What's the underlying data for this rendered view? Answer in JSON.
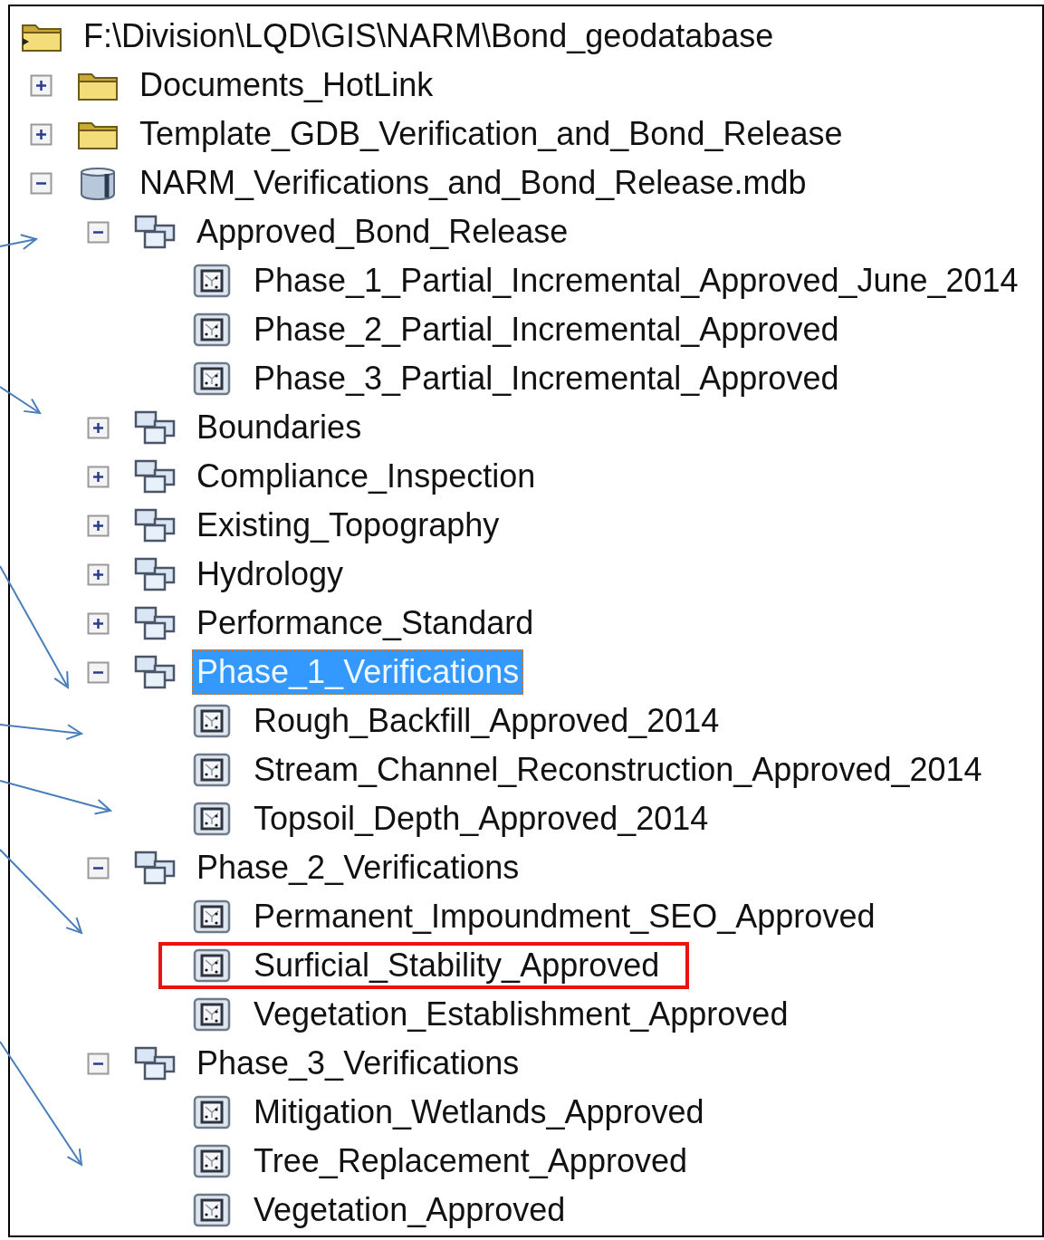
{
  "tree": {
    "label": "F:\\Division\\LQD\\GIS\\NARM\\Bond_geodatabase",
    "kind": "folder_connection",
    "selected": false,
    "boxed": false,
    "children": [
      {
        "label": "Documents_HotLink",
        "kind": "folder",
        "expanded": false,
        "selected": false,
        "boxed": false
      },
      {
        "label": "Template_GDB_Verification_and_Bond_Release",
        "kind": "folder",
        "expanded": false,
        "selected": false,
        "boxed": false
      },
      {
        "label": "NARM_Verifications_and_Bond_Release.mdb",
        "kind": "database",
        "expanded": true,
        "selected": false,
        "boxed": false,
        "children": [
          {
            "label": "Approved_Bond_Release",
            "kind": "dataset",
            "expanded": true,
            "selected": false,
            "boxed": false,
            "children": [
              {
                "label": "Phase_1_Partial_Incremental_Approved_June_2014",
                "kind": "feature_class",
                "selected": false,
                "boxed": false
              },
              {
                "label": "Phase_2_Partial_Incremental_Approved",
                "kind": "feature_class",
                "selected": false,
                "boxed": false
              },
              {
                "label": "Phase_3_Partial_Incremental_Approved",
                "kind": "feature_class",
                "selected": false,
                "boxed": false
              }
            ]
          },
          {
            "label": "Boundaries",
            "kind": "dataset",
            "expanded": false,
            "selected": false,
            "boxed": false
          },
          {
            "label": "Compliance_Inspection",
            "kind": "dataset",
            "expanded": false,
            "selected": false,
            "boxed": false
          },
          {
            "label": "Existing_Topography",
            "kind": "dataset",
            "expanded": false,
            "selected": false,
            "boxed": false
          },
          {
            "label": "Hydrology",
            "kind": "dataset",
            "expanded": false,
            "selected": false,
            "boxed": false
          },
          {
            "label": "Performance_Standard",
            "kind": "dataset",
            "expanded": false,
            "selected": false,
            "boxed": false
          },
          {
            "label": "Phase_1_Verifications",
            "kind": "dataset",
            "expanded": true,
            "selected": true,
            "boxed": false,
            "children": [
              {
                "label": "Rough_Backfill_Approved_2014",
                "kind": "feature_class",
                "selected": false,
                "boxed": false
              },
              {
                "label": "Stream_Channel_Reconstruction_Approved_2014",
                "kind": "feature_class",
                "selected": false,
                "boxed": false
              },
              {
                "label": "Topsoil_Depth_Approved_2014",
                "kind": "feature_class",
                "selected": false,
                "boxed": false
              }
            ]
          },
          {
            "label": "Phase_2_Verifications",
            "kind": "dataset",
            "expanded": true,
            "selected": false,
            "boxed": false,
            "children": [
              {
                "label": "Permanent_Impoundment_SEO_Approved",
                "kind": "feature_class",
                "selected": false,
                "boxed": false
              },
              {
                "label": "Surficial_Stability_Approved",
                "kind": "feature_class",
                "selected": false,
                "boxed": true
              },
              {
                "label": "Vegetation_Establishment_Approved",
                "kind": "feature_class",
                "selected": false,
                "boxed": false
              }
            ]
          },
          {
            "label": "Phase_3_Verifications",
            "kind": "dataset",
            "expanded": true,
            "selected": false,
            "boxed": false,
            "children": [
              {
                "label": "Mitigation_Wetlands_Approved",
                "kind": "feature_class",
                "selected": false,
                "boxed": false
              },
              {
                "label": "Tree_Replacement_Approved",
                "kind": "feature_class",
                "selected": false,
                "boxed": false
              },
              {
                "label": "Vegetation_Approved",
                "kind": "feature_class",
                "selected": false,
                "boxed": false
              }
            ]
          }
        ]
      }
    ]
  }
}
